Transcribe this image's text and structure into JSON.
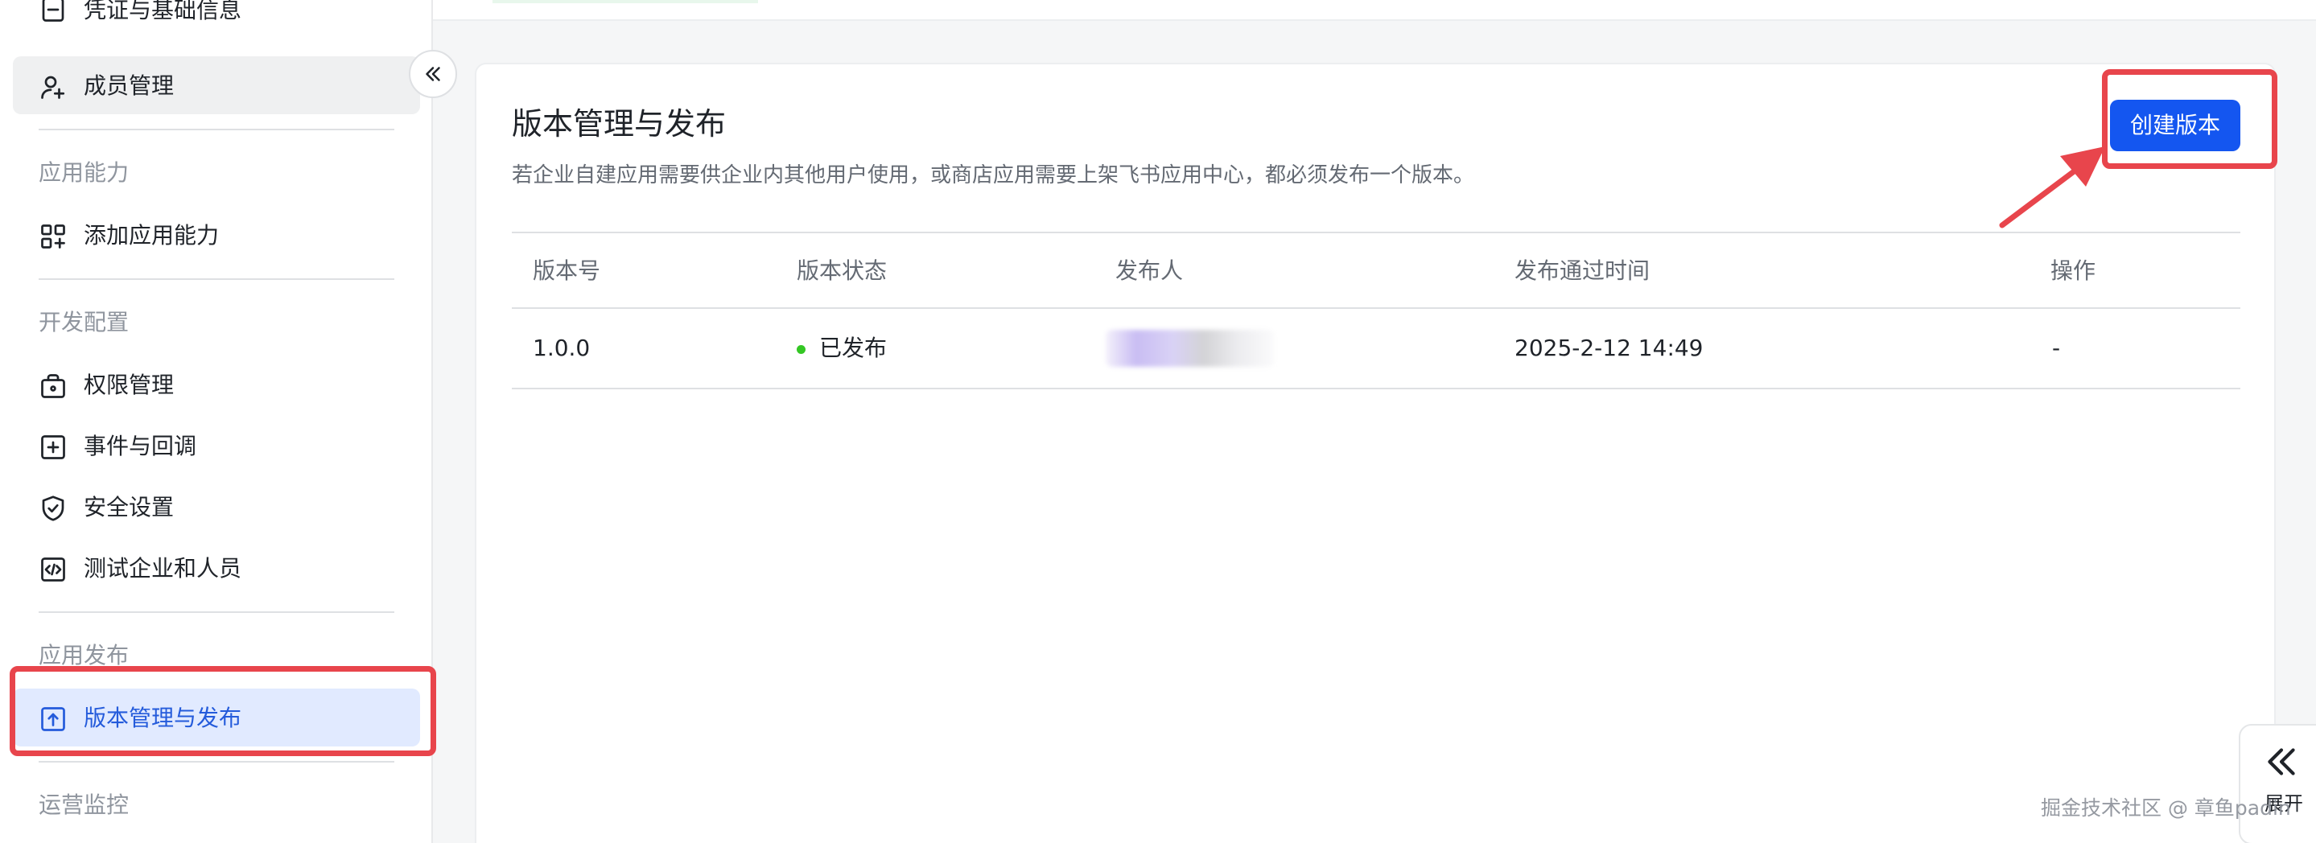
{
  "sidebar": {
    "top_item_partial": "凭证与基础信息",
    "members": "成员管理",
    "section_capabilities": "应用能力",
    "add_capability": "添加应用能力",
    "section_dev": "开发配置",
    "permissions": "权限管理",
    "events": "事件与回调",
    "security": "安全设置",
    "test_users": "测试企业和人员",
    "section_release": "应用发布",
    "version_release": "版本管理与发布",
    "section_ops": "运营监控"
  },
  "main": {
    "title": "版本管理与发布",
    "description": "若企业自建应用需要供企业内其他用户使用，或商店应用需要上架飞书应用中心，都必须发布一个版本。",
    "create_button": "创建版本",
    "table": {
      "headers": [
        "版本号",
        "版本状态",
        "发布人",
        "发布通过时间",
        "操作"
      ],
      "rows": [
        {
          "version": "1.0.0",
          "status": "已发布",
          "publish_time": "2025-2-12 14:49",
          "action": "-"
        }
      ]
    }
  },
  "expand_widget": {
    "label": "展开"
  },
  "watermark": "掘金技术社区 @ 章鱼padin"
}
